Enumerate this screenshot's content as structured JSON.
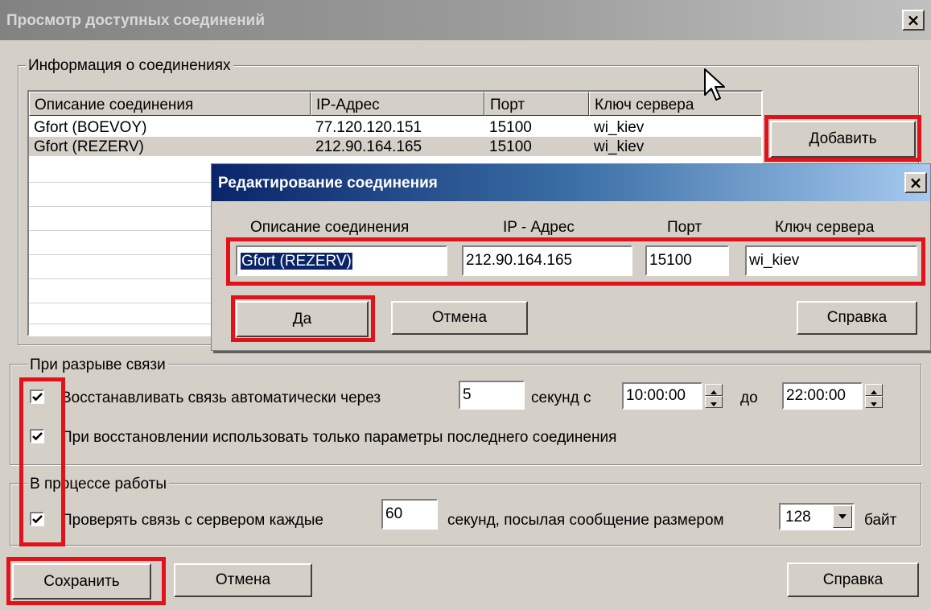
{
  "main_window": {
    "title": "Просмотр доступных соединений",
    "close_label": "×"
  },
  "connections_group": {
    "legend": "Информация о соединениях",
    "columns": [
      "Описание соединения",
      "IP-Адрес",
      "Порт",
      "Ключ сервера"
    ],
    "rows": [
      {
        "description": "Gfort (BOEVOY)",
        "ip": "77.120.120.151",
        "port": "15100",
        "key": "wi_kiev"
      },
      {
        "description": "Gfort (REZERV)",
        "ip": "212.90.164.165",
        "port": "15100",
        "key": "wi_kiev"
      }
    ],
    "add_label": "Добавить"
  },
  "disconnect_group": {
    "legend": "При разрыве связи",
    "auto_reconnect_label": "Восстанавливать связь автоматически через",
    "auto_reconnect_checked": true,
    "seconds_value": "5",
    "seconds_from_label": "секунд с",
    "time_from": "10:00:00",
    "to_label": "до",
    "time_to": "22:00:00",
    "last_params_label": "При восстановлении использовать только параметры последнего соединения",
    "last_params_checked": true
  },
  "work_group": {
    "legend": "В процессе работы",
    "check_label": "Проверять связь с сервером каждые",
    "check_checked": true,
    "interval_value": "60",
    "message_size_label": "секунд, посылая сообщение размером",
    "message_size_value": "128",
    "bytes_label": "байт"
  },
  "footer": {
    "save_label": "Сохранить",
    "cancel_label": "Отмена",
    "help_label": "Справка"
  },
  "edit_dialog": {
    "title": "Редактирование соединения",
    "close_label": "×",
    "description_label": "Описание соединения",
    "ip_label": "IP - Адрес",
    "port_label": "Порт",
    "key_label": "Ключ сервера",
    "description_value": "Gfort (REZERV)",
    "ip_value": "212.90.164.165",
    "port_value": "15100",
    "key_value": "wi_kiev",
    "ok_label": "Да",
    "cancel_label": "Отмена",
    "help_label": "Справка"
  },
  "colors": {
    "highlight_red": "#e3111a",
    "dialog_title_blue": "#0a246a",
    "face": "#d4d0c8"
  }
}
